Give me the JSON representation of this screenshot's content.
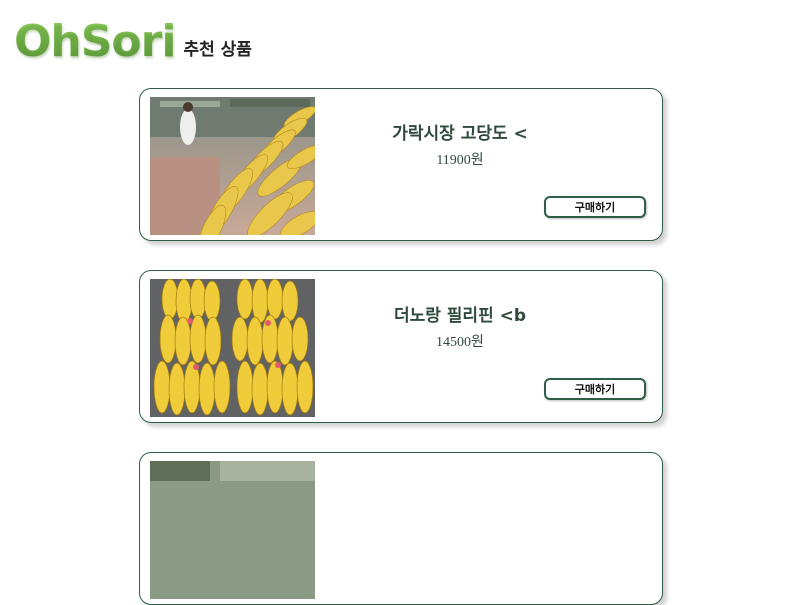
{
  "header": {
    "logo": "OhSori",
    "title": "추천 상품"
  },
  "products": [
    {
      "name": "가락시장 고당도 <",
      "price": "11900원",
      "buy_label": "구매하기"
    },
    {
      "name": "더노랑 필리핀 <b",
      "price": "14500원",
      "buy_label": "구매하기"
    }
  ]
}
